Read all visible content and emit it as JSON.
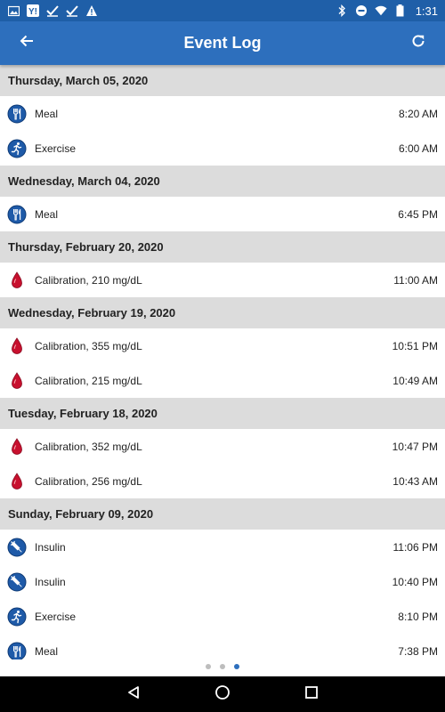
{
  "status_bar": {
    "time": "1:31",
    "left_icons": [
      "image-icon",
      "yahoo-icon",
      "check-icon",
      "check-icon",
      "warning-icon"
    ],
    "right_icons": [
      "bluetooth-icon",
      "do-not-disturb-icon",
      "wifi-icon",
      "battery-icon"
    ]
  },
  "app_bar": {
    "title": "Event Log",
    "back_icon": "arrow-back-icon",
    "refresh_icon": "refresh-icon",
    "color": "#2d6fbd"
  },
  "groups": [
    {
      "date": "Thursday, March 05, 2020",
      "events": [
        {
          "type": "meal",
          "label": "Meal",
          "time": "8:20 AM"
        },
        {
          "type": "exercise",
          "label": "Exercise",
          "time": "6:00 AM"
        }
      ]
    },
    {
      "date": "Wednesday, March 04, 2020",
      "events": [
        {
          "type": "meal",
          "label": "Meal",
          "time": "6:45 PM"
        }
      ]
    },
    {
      "date": "Thursday, February 20, 2020",
      "events": [
        {
          "type": "calibration",
          "label": "Calibration, 210 mg/dL",
          "time": "11:00 AM"
        }
      ]
    },
    {
      "date": "Wednesday, February 19, 2020",
      "events": [
        {
          "type": "calibration",
          "label": "Calibration, 355 mg/dL",
          "time": "10:51 PM"
        },
        {
          "type": "calibration",
          "label": "Calibration, 215 mg/dL",
          "time": "10:49 AM"
        }
      ]
    },
    {
      "date": "Tuesday, February 18, 2020",
      "events": [
        {
          "type": "calibration",
          "label": "Calibration, 352 mg/dL",
          "time": "10:47 PM"
        },
        {
          "type": "calibration",
          "label": "Calibration, 256 mg/dL",
          "time": "10:43 AM"
        }
      ]
    },
    {
      "date": "Sunday, February 09, 2020",
      "events": [
        {
          "type": "insulin",
          "label": "Insulin",
          "time": "11:06 PM"
        },
        {
          "type": "insulin",
          "label": "Insulin",
          "time": "10:40 PM"
        },
        {
          "type": "exercise",
          "label": "Exercise",
          "time": "8:10 PM"
        },
        {
          "type": "meal",
          "label": "Meal",
          "time": "7:38 PM"
        }
      ]
    }
  ],
  "pager": {
    "count": 3,
    "active_index": 2
  },
  "nav_bar": {
    "icons": [
      "back-triangle-icon",
      "home-circle-icon",
      "recents-square-icon"
    ]
  },
  "colors": {
    "header_bg": "#dcdcdc",
    "icon_blue": "#1e5aa8",
    "drop_red": "#c8102e"
  }
}
